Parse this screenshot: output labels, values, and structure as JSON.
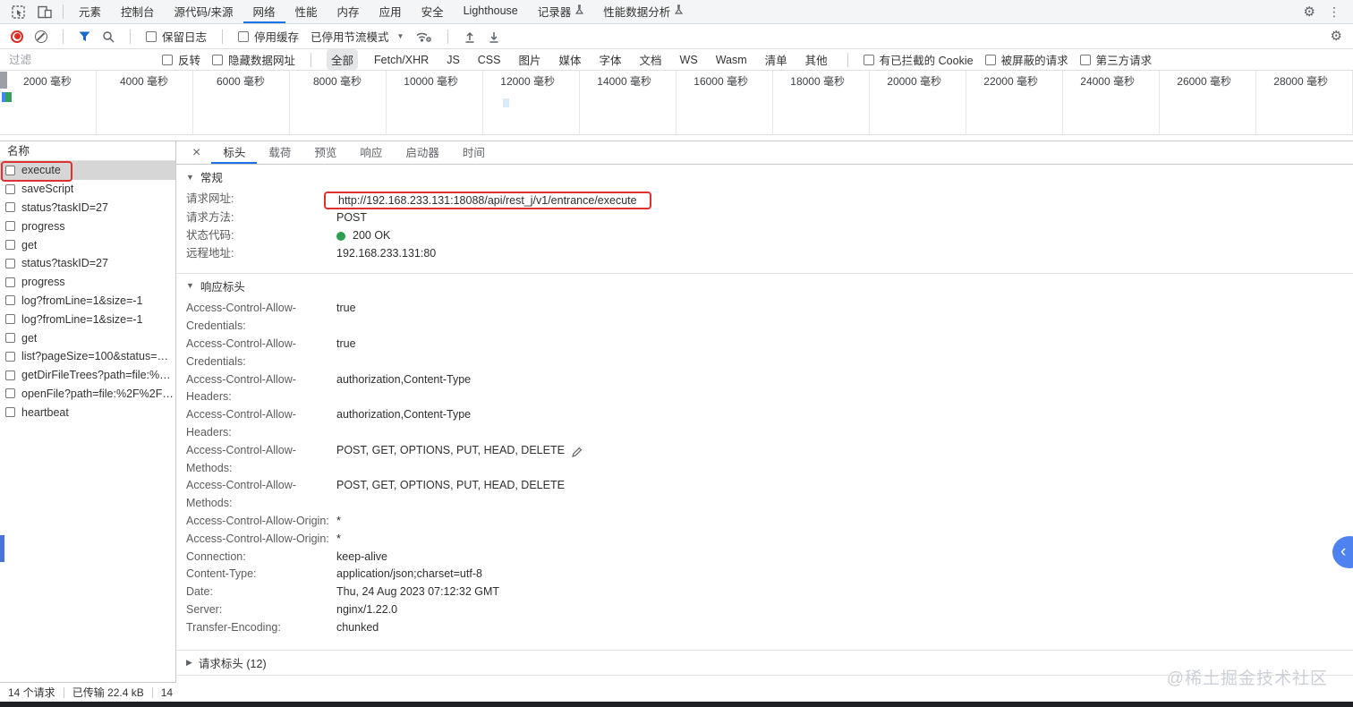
{
  "icons": {
    "gear": "⚙",
    "kebab": "⋮",
    "caret_down": "▼",
    "close": "×",
    "tri_down": "▼",
    "tri_right": "▶",
    "chevron_left": "‹"
  },
  "colors": {
    "accent": "#1a73e8",
    "annotation": "#e03131",
    "status_green": "#2da04c",
    "record_red": "#d93025",
    "selected_row": "#d6d6d6",
    "float_button": "#4e82f0"
  },
  "top_bar": {
    "tabs": [
      {
        "label": "元素"
      },
      {
        "label": "控制台"
      },
      {
        "label": "源代码/来源"
      },
      {
        "label": "网络"
      },
      {
        "label": "性能"
      },
      {
        "label": "内存"
      },
      {
        "label": "应用"
      },
      {
        "label": "安全"
      },
      {
        "label": "Lighthouse"
      },
      {
        "label": "记录器"
      },
      {
        "label": "性能数据分析"
      }
    ],
    "active_tab": "网络"
  },
  "network_toolbar": {
    "preserve_log_label": "保留日志",
    "disable_cache_label": "停用缓存",
    "throttling_value": "已停用节流模式"
  },
  "filter_bar": {
    "placeholder": "过滤",
    "invert_label": "反转",
    "hide_data_urls_label": "隐藏数据网址",
    "all_label": "全部",
    "types": [
      {
        "label": "Fetch/XHR"
      },
      {
        "label": "JS"
      },
      {
        "label": "CSS"
      },
      {
        "label": "图片"
      },
      {
        "label": "媒体"
      },
      {
        "label": "字体"
      },
      {
        "label": "文档"
      },
      {
        "label": "WS"
      },
      {
        "label": "Wasm"
      },
      {
        "label": "清单"
      },
      {
        "label": "其他"
      }
    ],
    "blocked_cookies_label": "有已拦截的 Cookie",
    "blocked_requests_label": "被屏蔽的请求",
    "third_party_label": "第三方请求"
  },
  "timeline": {
    "tick_labels": [
      {
        "label": "2000 毫秒"
      },
      {
        "label": "4000 毫秒"
      },
      {
        "label": "6000 毫秒"
      },
      {
        "label": "8000 毫秒"
      },
      {
        "label": "10000 毫秒"
      },
      {
        "label": "12000 毫秒"
      },
      {
        "label": "14000 毫秒"
      },
      {
        "label": "16000 毫秒"
      },
      {
        "label": "18000 毫秒"
      },
      {
        "label": "20000 毫秒"
      },
      {
        "label": "22000 毫秒"
      },
      {
        "label": "24000 毫秒"
      },
      {
        "label": "26000 毫秒"
      },
      {
        "label": "28000 毫秒"
      }
    ]
  },
  "request_list": {
    "header": "名称",
    "selected": "execute",
    "rows": [
      {
        "name": "execute"
      },
      {
        "name": "saveScript"
      },
      {
        "name": "status?taskID=27"
      },
      {
        "name": "progress"
      },
      {
        "name": "get"
      },
      {
        "name": "status?taskID=27"
      },
      {
        "name": "progress"
      },
      {
        "name": "log?fromLine=1&size=-1"
      },
      {
        "name": "log?fromLine=1&size=-1"
      },
      {
        "name": "get"
      },
      {
        "name": "list?pageSize=100&status=Ru..."
      },
      {
        "name": "getDirFileTrees?path=file:%2F..."
      },
      {
        "name": "openFile?path=file:%2F%2F%2..."
      },
      {
        "name": "heartbeat"
      }
    ]
  },
  "detail_panel": {
    "tabs": [
      {
        "label": "标头"
      },
      {
        "label": "载荷"
      },
      {
        "label": "预览"
      },
      {
        "label": "响应"
      },
      {
        "label": "启动器"
      },
      {
        "label": "时间"
      }
    ],
    "active_tab": "标头",
    "general": {
      "title": "常规",
      "rows": [
        {
          "name": "请求网址:",
          "value": "http://192.168.233.131:18088/api/rest_j/v1/entrance/execute",
          "annotated": true
        },
        {
          "name": "请求方法:",
          "value": "POST"
        },
        {
          "name": "状态代码:",
          "value": "200 OK",
          "status_dot": true
        },
        {
          "name": "远程地址:",
          "value": "192.168.233.131:80"
        }
      ]
    },
    "response_headers": {
      "title": "响应标头",
      "rows": [
        {
          "name": "Access-Control-Allow-Credentials:",
          "value": "true"
        },
        {
          "name": "Access-Control-Allow-Credentials:",
          "value": "true"
        },
        {
          "name": "Access-Control-Allow-Headers:",
          "value": "authorization,Content-Type"
        },
        {
          "name": "Access-Control-Allow-Headers:",
          "value": "authorization,Content-Type"
        },
        {
          "name": "Access-Control-Allow-Methods:",
          "value": "POST, GET, OPTIONS, PUT, HEAD, DELETE",
          "editable": true
        },
        {
          "name": "Access-Control-Allow-Methods:",
          "value": "POST, GET, OPTIONS, PUT, HEAD, DELETE"
        },
        {
          "name": "Access-Control-Allow-Origin:",
          "value": "*"
        },
        {
          "name": "Access-Control-Allow-Origin:",
          "value": "*"
        },
        {
          "name": "Connection:",
          "value": "keep-alive"
        },
        {
          "name": "Content-Type:",
          "value": "application/json;charset=utf-8"
        },
        {
          "name": "Date:",
          "value": "Thu, 24 Aug 2023 07:12:32 GMT"
        },
        {
          "name": "Server:",
          "value": "nginx/1.22.0"
        },
        {
          "name": "Transfer-Encoding:",
          "value": "chunked"
        }
      ]
    },
    "request_headers": {
      "title": "请求标头 (12)"
    }
  },
  "status_bar": {
    "requests": "14 个请求",
    "transferred": "已传输 22.4 kB",
    "extra": "14"
  },
  "watermark": "@稀土掘金技术社区"
}
